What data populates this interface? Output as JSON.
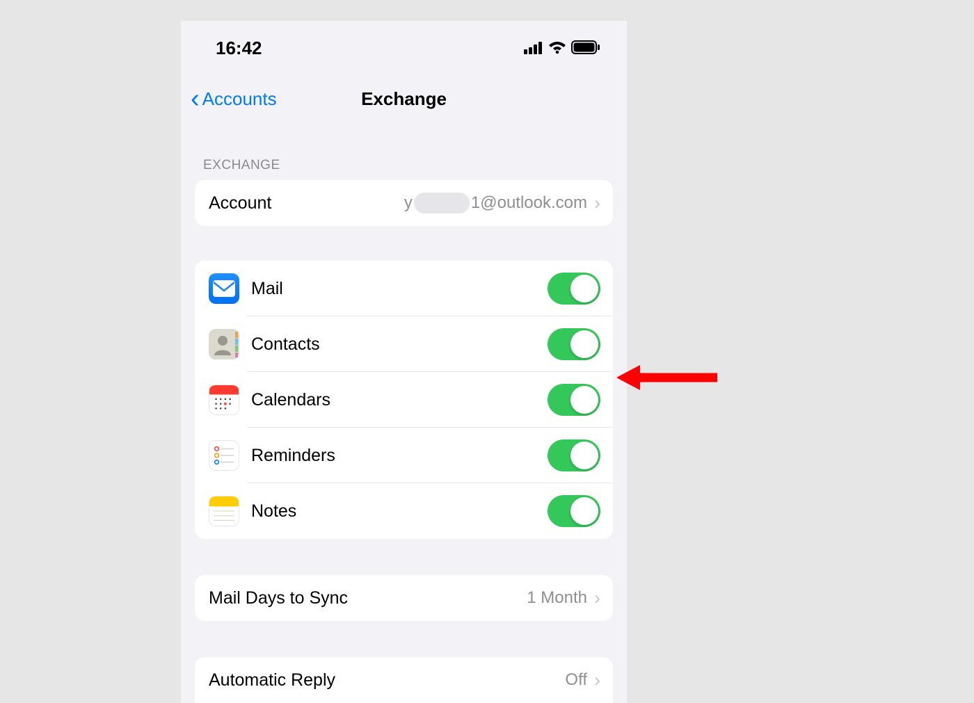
{
  "status": {
    "time": "16:42"
  },
  "nav": {
    "back_label": "Accounts",
    "title": "Exchange"
  },
  "sections": {
    "exchange_header": "EXCHANGE",
    "account": {
      "label": "Account",
      "value_prefix": "y",
      "value_suffix": "1@outlook.com"
    },
    "services": [
      {
        "key": "mail",
        "label": "Mail",
        "on": true
      },
      {
        "key": "contacts",
        "label": "Contacts",
        "on": true
      },
      {
        "key": "calendars",
        "label": "Calendars",
        "on": true
      },
      {
        "key": "reminders",
        "label": "Reminders",
        "on": true
      },
      {
        "key": "notes",
        "label": "Notes",
        "on": true
      }
    ],
    "mail_days": {
      "label": "Mail Days to Sync",
      "value": "1 Month"
    },
    "auto_reply": {
      "label": "Automatic Reply",
      "value": "Off"
    }
  }
}
